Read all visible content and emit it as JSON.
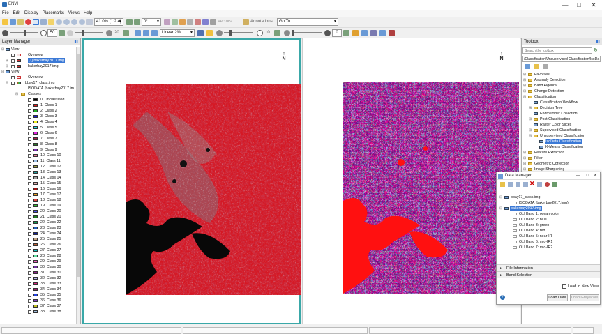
{
  "app": {
    "title": "ENVI"
  },
  "window_controls": {
    "minimize": "—",
    "maximize": "□",
    "close": "✕"
  },
  "menu": [
    "File",
    "Edit",
    "Display",
    "Placemarks",
    "Views",
    "Help"
  ],
  "toolbar1": {
    "zoom": "41.0% (1:2.4)",
    "rotation": "0°",
    "vectors": "Vectors",
    "annotations": "Annotations",
    "goto": "Go To"
  },
  "toolbar2": {
    "brightness": "50",
    "contrast": "20",
    "stretch": "Linear 2%",
    "sharpen": "10",
    "transparency": "0"
  },
  "layer_manager": {
    "title": "Layer Manager",
    "view1": {
      "label": "View",
      "overview": "Overview",
      "layers": [
        "[1] bakerbay2017.img",
        "bakerbay2017.img"
      ]
    },
    "view2": {
      "label": "View",
      "overview": "Overview",
      "layer": "bbay17_class.img",
      "isodata": "ISODATA (bakerbay2017.im",
      "classes_label": "Classes"
    },
    "classes": [
      {
        "name": "0: Unclassified",
        "color": "#000000"
      },
      {
        "name": "1: Class 1",
        "color": "#e81919"
      },
      {
        "name": "2: Class 2",
        "color": "#22b022"
      },
      {
        "name": "3: Class 3",
        "color": "#1a1ae0"
      },
      {
        "name": "4: Class 4",
        "color": "#f0f020"
      },
      {
        "name": "5: Class 5",
        "color": "#20e0e0"
      },
      {
        "name": "6: Class 6",
        "color": "#e020e0"
      },
      {
        "name": "7: Class 7",
        "color": "#b01a4a"
      },
      {
        "name": "8: Class 8",
        "color": "#2a7a2a"
      },
      {
        "name": "9: Class 9",
        "color": "#7a2ab0"
      },
      {
        "name": "10: Class 10",
        "color": "#e87a9a"
      },
      {
        "name": "11: Class 11",
        "color": "#9ac0e8"
      },
      {
        "name": "12: Class 12",
        "color": "#9aa040"
      },
      {
        "name": "13: Class 13",
        "color": "#20a0a0"
      },
      {
        "name": "14: Class 14",
        "color": "#a0a0a0"
      },
      {
        "name": "15: Class 15",
        "color": "#e0b0b0"
      },
      {
        "name": "16: Class 16",
        "color": "#a01010"
      },
      {
        "name": "17: Class 17",
        "color": "#f0a020"
      },
      {
        "name": "18: Class 18",
        "color": "#e04040"
      },
      {
        "name": "19: Class 19",
        "color": "#30c030"
      },
      {
        "name": "20: Class 20",
        "color": "#5050f0"
      },
      {
        "name": "21: Class 21",
        "color": "#208020"
      },
      {
        "name": "22: Class 22",
        "color": "#10a050"
      },
      {
        "name": "23: Class 23",
        "color": "#2060c0"
      },
      {
        "name": "24: Class 24",
        "color": "#1020a0"
      },
      {
        "name": "25: Class 25",
        "color": "#c0a080"
      },
      {
        "name": "26: Class 26",
        "color": "#c06030"
      },
      {
        "name": "27: Class 27",
        "color": "#10c0c0"
      },
      {
        "name": "28: Class 28",
        "color": "#60e0a0"
      },
      {
        "name": "29: Class 29",
        "color": "#f060c0"
      },
      {
        "name": "30: Class 30",
        "color": "#7030a0"
      },
      {
        "name": "31: Class 31",
        "color": "#902090"
      },
      {
        "name": "32: Class 32",
        "color": "#b0b0f0"
      },
      {
        "name": "33: Class 33",
        "color": "#e02080"
      },
      {
        "name": "34: Class 34",
        "color": "#a02070"
      },
      {
        "name": "35: Class 35",
        "color": "#2040e0"
      },
      {
        "name": "36: Class 36",
        "color": "#8040c0"
      },
      {
        "name": "37: Class 37",
        "color": "#c0c020"
      },
      {
        "name": "38: Class 38",
        "color": "#a0c0e0"
      }
    ]
  },
  "toolbox": {
    "title": "Toolbox",
    "search_placeholder": "Search the toolbox",
    "path": "/Classification/Unsupervised Classification/IsoDa",
    "items": [
      {
        "label": "Favorites",
        "level": 0,
        "type": "folder"
      },
      {
        "label": "Anomaly Detection",
        "level": 0,
        "type": "folder"
      },
      {
        "label": "Band Algebra",
        "level": 0,
        "type": "folder"
      },
      {
        "label": "Change Detection",
        "level": 0,
        "type": "folder"
      },
      {
        "label": "Classification",
        "level": 0,
        "type": "folder"
      },
      {
        "label": "Classification Workflow",
        "level": 1,
        "type": "tool"
      },
      {
        "label": "Decision Tree",
        "level": 1,
        "type": "folder"
      },
      {
        "label": "Endmember Collection",
        "level": 1,
        "type": "tool"
      },
      {
        "label": "Post Classification",
        "level": 1,
        "type": "folder"
      },
      {
        "label": "Raster Color Slices",
        "level": 1,
        "type": "tool"
      },
      {
        "label": "Supervised Classification",
        "level": 1,
        "type": "folder"
      },
      {
        "label": "Unsupervised Classification",
        "level": 1,
        "type": "folder"
      },
      {
        "label": "IsoData Classification",
        "level": 2,
        "type": "tool",
        "selected": true
      },
      {
        "label": "K-Means Classification",
        "level": 2,
        "type": "tool"
      },
      {
        "label": "Feature Extraction",
        "level": 0,
        "type": "folder"
      },
      {
        "label": "Filter",
        "level": 0,
        "type": "folder"
      },
      {
        "label": "Geometric Correction",
        "level": 0,
        "type": "folder"
      },
      {
        "label": "Image Sharpening",
        "level": 0,
        "type": "folder"
      }
    ]
  },
  "data_manager": {
    "title": "Data Manager",
    "files": [
      {
        "label": "bbay17_class.img",
        "level": 0
      },
      {
        "label": "ISODATA (bakerbay2017.img)",
        "level": 1
      },
      {
        "label": "bakerbay2017.img",
        "level": 0,
        "selected": true
      },
      {
        "label": "OLI Band 1: ocean color",
        "level": 1
      },
      {
        "label": "OLI Band 2: blue",
        "level": 1
      },
      {
        "label": "OLI Band 3: green",
        "level": 1
      },
      {
        "label": "OLI Band 4: red",
        "level": 1
      },
      {
        "label": "OLI Band 5: near-IR",
        "level": 1
      },
      {
        "label": "OLI Band 6: mid-IR1",
        "level": 1
      },
      {
        "label": "OLI Band 7: mid-IR2",
        "level": 1
      }
    ],
    "file_information": "File Information",
    "band_selection": "Band Selection",
    "load_in_new_view": "Load in New View",
    "load_data": "Load Data",
    "load_grayscale": "Load Grayscale"
  },
  "views": {
    "north_label": "N"
  }
}
